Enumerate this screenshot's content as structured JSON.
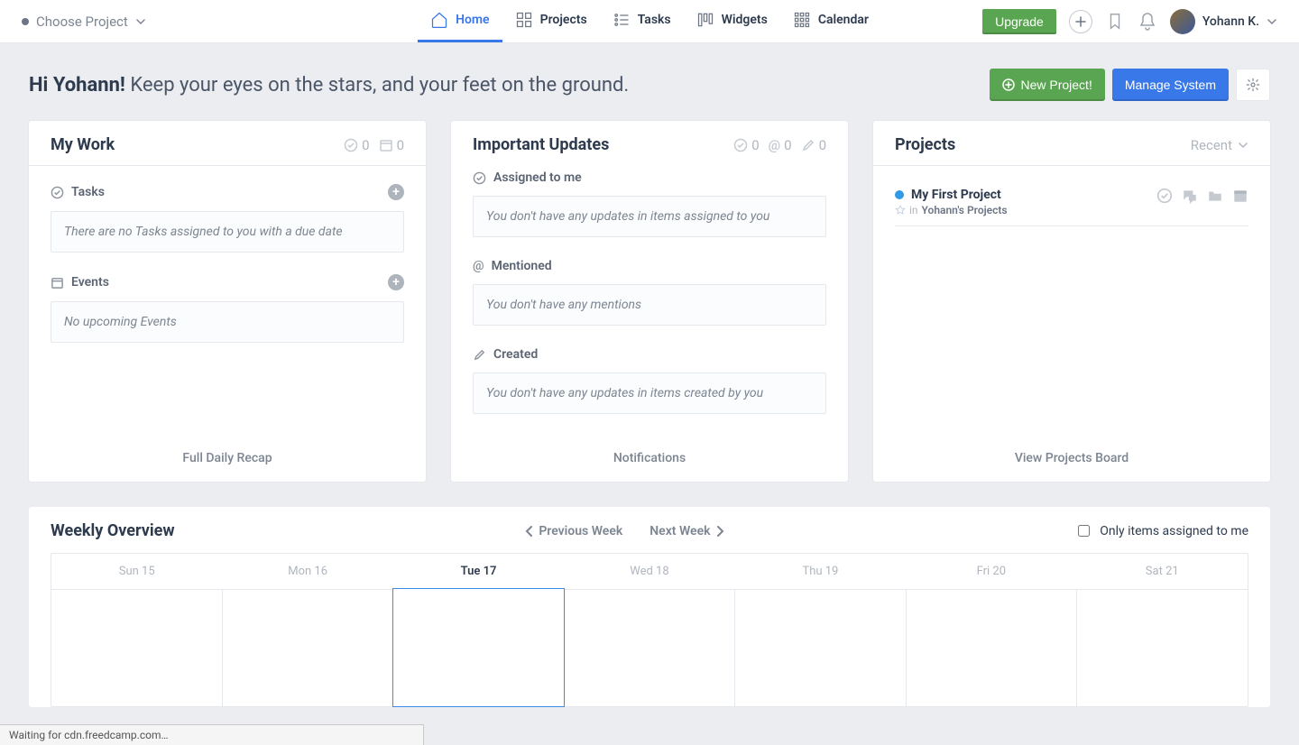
{
  "topbar": {
    "choose_project": "Choose Project",
    "nav": {
      "home": "Home",
      "projects": "Projects",
      "tasks": "Tasks",
      "widgets": "Widgets",
      "calendar": "Calendar"
    },
    "upgrade": "Upgrade",
    "user_name": "Yohann K."
  },
  "header": {
    "greeting_bold": "Hi Yohann!",
    "greeting_rest": "Keep your eyes on the stars, and your feet on the ground.",
    "new_project": "New Project!",
    "manage_system": "Manage System"
  },
  "my_work": {
    "title": "My Work",
    "meta_tasks": "0",
    "meta_events": "0",
    "tasks_label": "Tasks",
    "tasks_empty": "There are no Tasks assigned to you with a due date",
    "events_label": "Events",
    "events_empty": "No upcoming Events",
    "footer": "Full Daily Recap"
  },
  "updates": {
    "title": "Important Updates",
    "meta_assigned": "0",
    "meta_mentioned": "0",
    "meta_created": "0",
    "assigned_label": "Assigned to me",
    "assigned_empty": "You don't have any updates in items assigned to you",
    "mentioned_label": "Mentioned",
    "mentioned_empty": "You don't have any mentions",
    "created_label": "Created",
    "created_empty": "You don't have any updates in items created by you",
    "footer": "Notifications"
  },
  "projects": {
    "title": "Projects",
    "filter": "Recent",
    "item_name": "My First Project",
    "item_in": "in",
    "item_group": "Yohann's Projects",
    "footer": "View Projects Board"
  },
  "weekly": {
    "title": "Weekly Overview",
    "prev": "Previous Week",
    "next": "Next Week",
    "filter_label": "Only items assigned to me",
    "days": {
      "d0": "Sun 15",
      "d1": "Mon 16",
      "d2": "Tue 17",
      "d3": "Wed 18",
      "d4": "Thu 19",
      "d5": "Fri 20",
      "d6": "Sat 21"
    }
  },
  "statusbar": "Waiting for cdn.freedcamp.com…"
}
